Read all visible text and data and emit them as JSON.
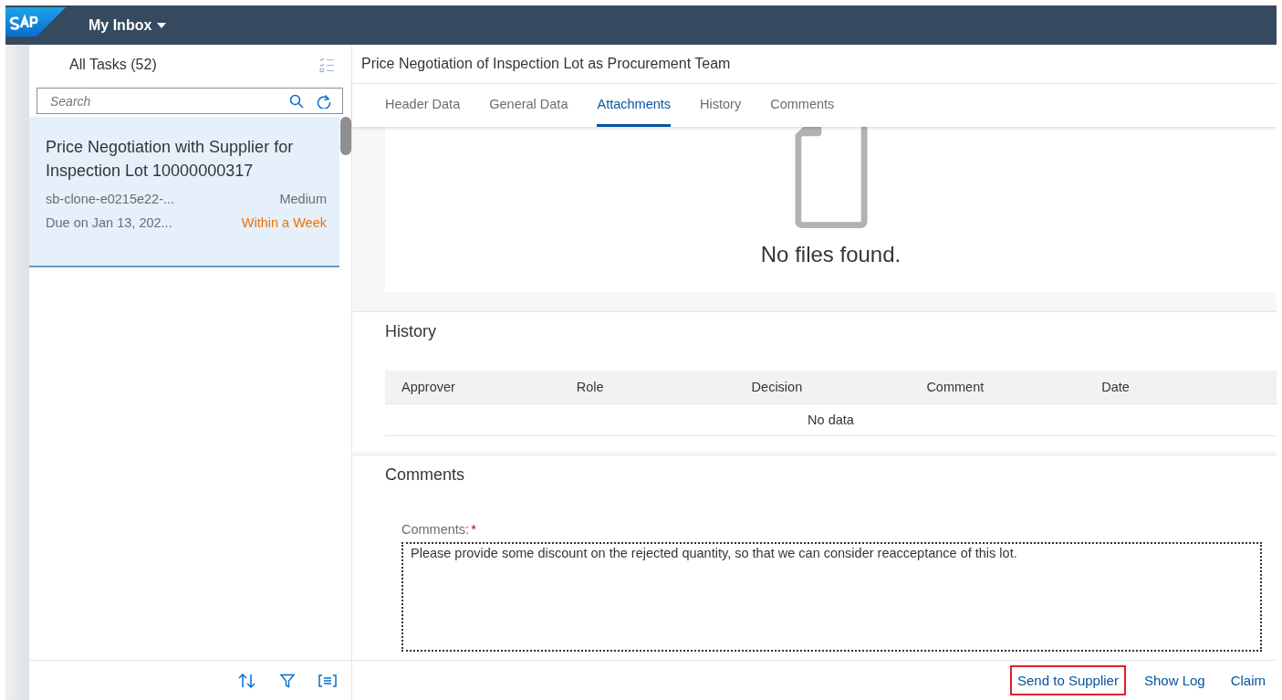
{
  "shell": {
    "title": "My Inbox"
  },
  "task_list": {
    "title": "All Tasks (52)",
    "search": {
      "placeholder": "Search"
    },
    "items": [
      {
        "title": "Price Negotiation with Supplier for Inspection Lot 10000000317",
        "created_by": "sb-clone-e0215e22-...",
        "priority": "Medium",
        "due": "Due on Jan 13, 202...",
        "status": "Within a Week",
        "selected": true
      }
    ]
  },
  "detail": {
    "title": "Price Negotiation of Inspection Lot as Procurement Team",
    "tabs": [
      {
        "label": "Header Data",
        "selected": false
      },
      {
        "label": "General Data",
        "selected": false
      },
      {
        "label": "Attachments",
        "selected": true
      },
      {
        "label": "History",
        "selected": false
      },
      {
        "label": "Comments",
        "selected": false
      }
    ],
    "attachments": {
      "empty_text": "No files found."
    },
    "history": {
      "title": "History",
      "columns": [
        "Approver",
        "Role",
        "Decision",
        "Comment",
        "Date"
      ],
      "empty_text": "No data"
    },
    "comments": {
      "title": "Comments",
      "label": "Comments:",
      "required_mark": "*",
      "value": "Please provide some discount on the rejected quantity, so that we can consider reacceptance of this lot."
    },
    "actions": [
      {
        "label": "Send to Supplier",
        "highlighted": true
      },
      {
        "label": "Show Log",
        "highlighted": false
      },
      {
        "label": "Claim",
        "highlighted": false
      }
    ]
  }
}
